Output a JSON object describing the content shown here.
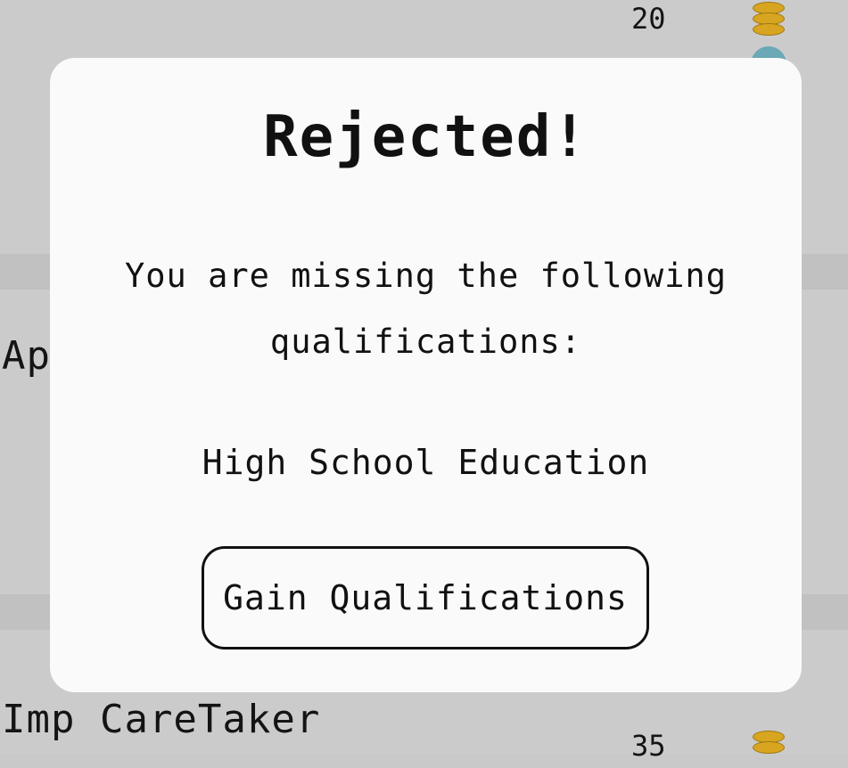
{
  "background": {
    "jobs": [
      {
        "title": "Ap",
        "pay": "20"
      },
      {
        "title": "Imp CareTaker",
        "pay": "35"
      }
    ]
  },
  "dialog": {
    "title": "Rejected!",
    "message": "You are missing the following qualifications:",
    "qualification": "High School Education",
    "button_label": "Gain Qualifications"
  },
  "colors": {
    "dialog_bg": "#fafafa",
    "backdrop": "#c9c9c9",
    "coin": "#d8a520"
  }
}
